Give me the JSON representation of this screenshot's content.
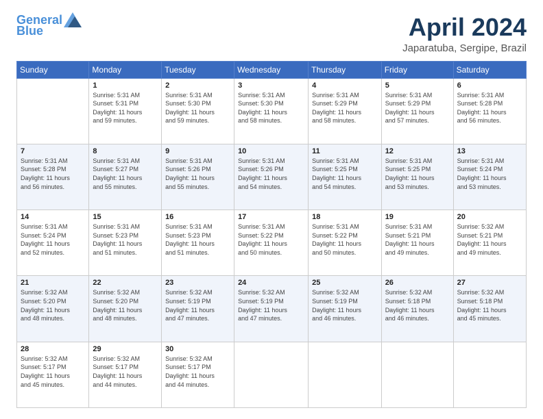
{
  "header": {
    "logo_line1": "General",
    "logo_line2": "Blue",
    "month": "April 2024",
    "location": "Japaratuba, Sergipe, Brazil"
  },
  "weekdays": [
    "Sunday",
    "Monday",
    "Tuesday",
    "Wednesday",
    "Thursday",
    "Friday",
    "Saturday"
  ],
  "weeks": [
    [
      {
        "day": "",
        "info": ""
      },
      {
        "day": "1",
        "info": "Sunrise: 5:31 AM\nSunset: 5:31 PM\nDaylight: 11 hours\nand 59 minutes."
      },
      {
        "day": "2",
        "info": "Sunrise: 5:31 AM\nSunset: 5:30 PM\nDaylight: 11 hours\nand 59 minutes."
      },
      {
        "day": "3",
        "info": "Sunrise: 5:31 AM\nSunset: 5:30 PM\nDaylight: 11 hours\nand 58 minutes."
      },
      {
        "day": "4",
        "info": "Sunrise: 5:31 AM\nSunset: 5:29 PM\nDaylight: 11 hours\nand 58 minutes."
      },
      {
        "day": "5",
        "info": "Sunrise: 5:31 AM\nSunset: 5:29 PM\nDaylight: 11 hours\nand 57 minutes."
      },
      {
        "day": "6",
        "info": "Sunrise: 5:31 AM\nSunset: 5:28 PM\nDaylight: 11 hours\nand 56 minutes."
      }
    ],
    [
      {
        "day": "7",
        "info": "Sunrise: 5:31 AM\nSunset: 5:28 PM\nDaylight: 11 hours\nand 56 minutes."
      },
      {
        "day": "8",
        "info": "Sunrise: 5:31 AM\nSunset: 5:27 PM\nDaylight: 11 hours\nand 55 minutes."
      },
      {
        "day": "9",
        "info": "Sunrise: 5:31 AM\nSunset: 5:26 PM\nDaylight: 11 hours\nand 55 minutes."
      },
      {
        "day": "10",
        "info": "Sunrise: 5:31 AM\nSunset: 5:26 PM\nDaylight: 11 hours\nand 54 minutes."
      },
      {
        "day": "11",
        "info": "Sunrise: 5:31 AM\nSunset: 5:25 PM\nDaylight: 11 hours\nand 54 minutes."
      },
      {
        "day": "12",
        "info": "Sunrise: 5:31 AM\nSunset: 5:25 PM\nDaylight: 11 hours\nand 53 minutes."
      },
      {
        "day": "13",
        "info": "Sunrise: 5:31 AM\nSunset: 5:24 PM\nDaylight: 11 hours\nand 53 minutes."
      }
    ],
    [
      {
        "day": "14",
        "info": "Sunrise: 5:31 AM\nSunset: 5:24 PM\nDaylight: 11 hours\nand 52 minutes."
      },
      {
        "day": "15",
        "info": "Sunrise: 5:31 AM\nSunset: 5:23 PM\nDaylight: 11 hours\nand 51 minutes."
      },
      {
        "day": "16",
        "info": "Sunrise: 5:31 AM\nSunset: 5:23 PM\nDaylight: 11 hours\nand 51 minutes."
      },
      {
        "day": "17",
        "info": "Sunrise: 5:31 AM\nSunset: 5:22 PM\nDaylight: 11 hours\nand 50 minutes."
      },
      {
        "day": "18",
        "info": "Sunrise: 5:31 AM\nSunset: 5:22 PM\nDaylight: 11 hours\nand 50 minutes."
      },
      {
        "day": "19",
        "info": "Sunrise: 5:31 AM\nSunset: 5:21 PM\nDaylight: 11 hours\nand 49 minutes."
      },
      {
        "day": "20",
        "info": "Sunrise: 5:32 AM\nSunset: 5:21 PM\nDaylight: 11 hours\nand 49 minutes."
      }
    ],
    [
      {
        "day": "21",
        "info": "Sunrise: 5:32 AM\nSunset: 5:20 PM\nDaylight: 11 hours\nand 48 minutes."
      },
      {
        "day": "22",
        "info": "Sunrise: 5:32 AM\nSunset: 5:20 PM\nDaylight: 11 hours\nand 48 minutes."
      },
      {
        "day": "23",
        "info": "Sunrise: 5:32 AM\nSunset: 5:19 PM\nDaylight: 11 hours\nand 47 minutes."
      },
      {
        "day": "24",
        "info": "Sunrise: 5:32 AM\nSunset: 5:19 PM\nDaylight: 11 hours\nand 47 minutes."
      },
      {
        "day": "25",
        "info": "Sunrise: 5:32 AM\nSunset: 5:19 PM\nDaylight: 11 hours\nand 46 minutes."
      },
      {
        "day": "26",
        "info": "Sunrise: 5:32 AM\nSunset: 5:18 PM\nDaylight: 11 hours\nand 46 minutes."
      },
      {
        "day": "27",
        "info": "Sunrise: 5:32 AM\nSunset: 5:18 PM\nDaylight: 11 hours\nand 45 minutes."
      }
    ],
    [
      {
        "day": "28",
        "info": "Sunrise: 5:32 AM\nSunset: 5:17 PM\nDaylight: 11 hours\nand 45 minutes."
      },
      {
        "day": "29",
        "info": "Sunrise: 5:32 AM\nSunset: 5:17 PM\nDaylight: 11 hours\nand 44 minutes."
      },
      {
        "day": "30",
        "info": "Sunrise: 5:32 AM\nSunset: 5:17 PM\nDaylight: 11 hours\nand 44 minutes."
      },
      {
        "day": "",
        "info": ""
      },
      {
        "day": "",
        "info": ""
      },
      {
        "day": "",
        "info": ""
      },
      {
        "day": "",
        "info": ""
      }
    ]
  ]
}
